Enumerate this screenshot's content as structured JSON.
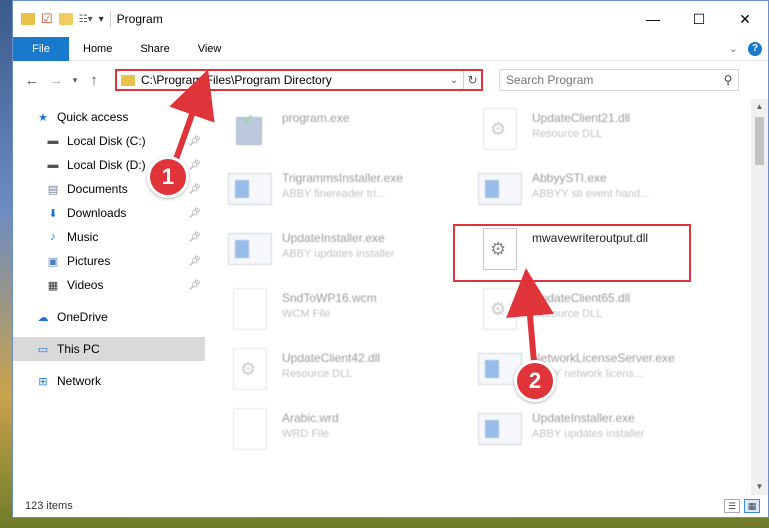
{
  "window": {
    "title": "Program",
    "min_icon": "minimize-icon",
    "max_icon": "maximize-icon",
    "close_icon": "close-icon"
  },
  "ribbon": {
    "tabs": [
      "File",
      "Home",
      "Share",
      "View"
    ]
  },
  "address": {
    "path": "C:\\Program Files\\Program Directory"
  },
  "search": {
    "placeholder": "Search Program"
  },
  "sidebar": {
    "items": [
      {
        "label": "Quick access",
        "icon": "star-icon"
      },
      {
        "label": "Local Disk (C:)",
        "icon": "drive-icon"
      },
      {
        "label": "Local Disk (D:)",
        "icon": "drive-icon"
      },
      {
        "label": "Documents",
        "icon": "documents-icon"
      },
      {
        "label": "Downloads",
        "icon": "download-arrow-icon"
      },
      {
        "label": "Music",
        "icon": "music-note-icon"
      },
      {
        "label": "Pictures",
        "icon": "pictures-icon"
      },
      {
        "label": "Videos",
        "icon": "film-icon"
      },
      {
        "label": "OneDrive",
        "icon": "cloud-icon"
      },
      {
        "label": "This PC",
        "icon": "monitor-icon"
      },
      {
        "label": "Network",
        "icon": "network-icon"
      }
    ]
  },
  "files": [
    {
      "name": "program.exe",
      "desc": ""
    },
    {
      "name": "UpdateClient21.dll",
      "desc": "Resource DLL"
    },
    {
      "name": "TrigrammsInstaller.exe",
      "desc": "ABBY finereader tri..."
    },
    {
      "name": "AbbyySTI.exe",
      "desc": "ABBYY sti event hand..."
    },
    {
      "name": "UpdateInstaller.exe",
      "desc": "ABBY updates installer"
    },
    {
      "name": "mwavewriteroutput.dll",
      "desc": ""
    },
    {
      "name": "SndToWP16.wcm",
      "desc": "WCM File"
    },
    {
      "name": "UpdateClient65.dll",
      "desc": "Resource DLL"
    },
    {
      "name": "UpdateClient42.dll",
      "desc": "Resource DLL"
    },
    {
      "name": "NetworkLicenseServer.exe",
      "desc": "ABBY network licens..."
    },
    {
      "name": "Arabic.wrd",
      "desc": "WRD File"
    },
    {
      "name": "UpdateInstaller.exe",
      "desc": "ABBY updates installer"
    }
  ],
  "status": {
    "count": "123 items"
  },
  "annotations": {
    "badge1": "1",
    "badge2": "2"
  },
  "colors": {
    "accent": "#1979ca",
    "highlight": "#e0343b"
  }
}
